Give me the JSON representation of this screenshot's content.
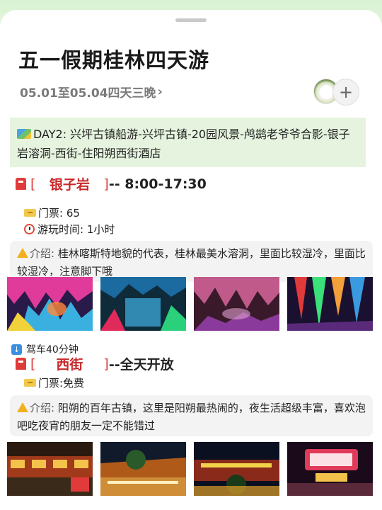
{
  "header": {
    "title": "五一假期桂林四天游",
    "subtitle": "05.01至05.04四天三晚",
    "subtitle_chevron": "›",
    "add_label": "+"
  },
  "day": {
    "text": "DAY2: 兴坪古镇船游-兴坪古镇-20园风景-鸬鹚老爷爷合影-银子岩溶洞-西街-住阳朔西街酒店",
    "icon": "map-icon"
  },
  "spots": [
    {
      "bracket_open": "[",
      "name": "银子岩",
      "bracket_close": "]",
      "time": "-- 8:00-17:30",
      "ticket": "门票: 65",
      "duration": "游玩时间: 1小时",
      "note_label": "介绍:",
      "note": "桂林喀斯特地貌的代表，桂林最美水溶洞，里面比较湿冷，里面比较湿冷，注意脚下哦"
    },
    {
      "bracket_open": "[",
      "name": "西街",
      "bracket_close": "]",
      "time": "--全天开放",
      "ticket": "门票:免费",
      "note_label": "介绍:",
      "note": "阳朔的百年古镇，这里是阳朔最热闹的，夜生活超级丰富，喜欢泡吧吃夜宵的朋友一定不能错过"
    }
  ],
  "transit": "驾车40分钟",
  "colors": {
    "accent_red": "#c82828",
    "day_bg": "#e6f4df",
    "note_bg": "#f3f3f3"
  }
}
